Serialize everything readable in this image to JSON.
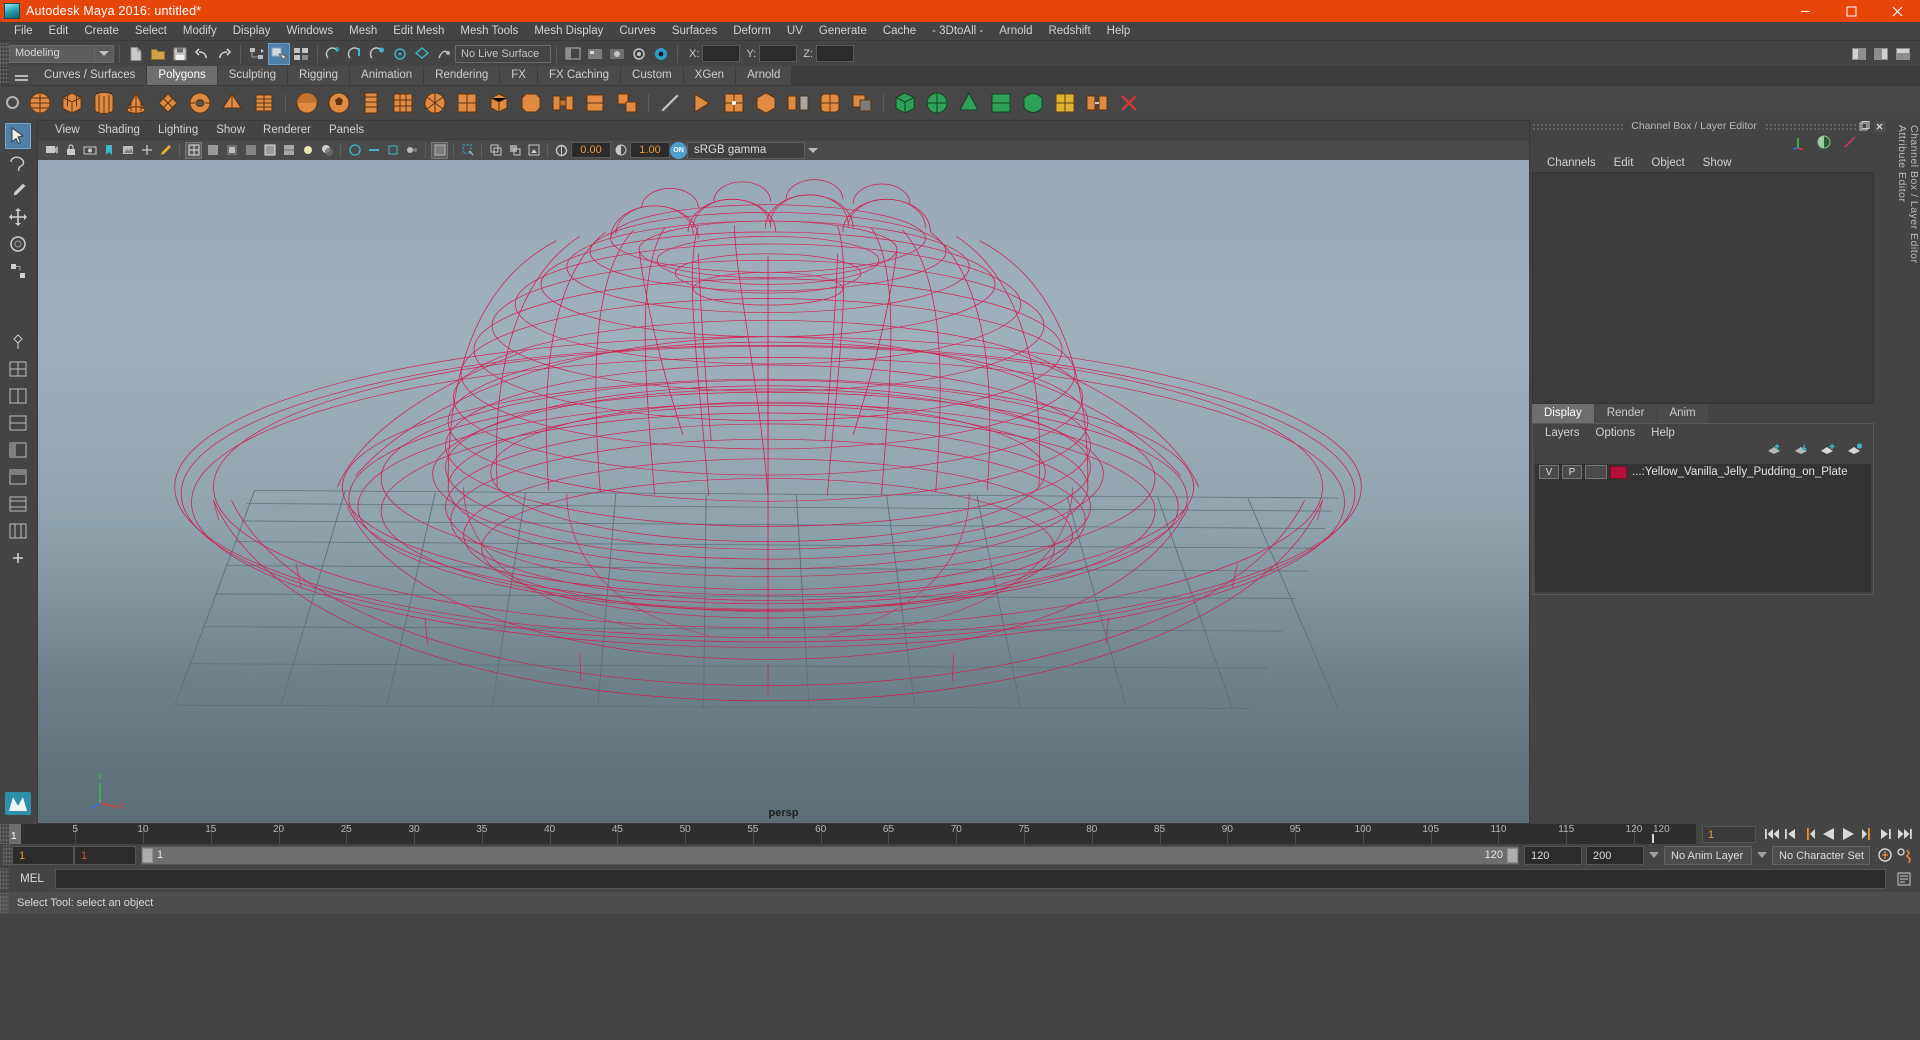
{
  "window": {
    "title": "Autodesk Maya 2016: untitled*",
    "logo_icon": "maya-logo-icon",
    "minimize_icon": "minimize-icon",
    "maximize_icon": "maximize-icon",
    "close_icon": "close-icon"
  },
  "menubar": {
    "items": [
      "File",
      "Edit",
      "Create",
      "Select",
      "Modify",
      "Display",
      "Windows",
      "Mesh",
      "Edit Mesh",
      "Mesh Tools",
      "Mesh Display",
      "Curves",
      "Surfaces",
      "Deform",
      "UV",
      "Generate",
      "Cache",
      "- 3DtoAll -",
      "Arnold",
      "Redshift",
      "Help"
    ]
  },
  "statusline": {
    "mode_selector": "Modeling",
    "live_surface": "No Live Surface",
    "axis_x_label": "X:",
    "axis_y_label": "Y:",
    "axis_z_label": "Z:",
    "axis_x_value": "",
    "axis_y_value": "",
    "axis_z_value": ""
  },
  "shelf": {
    "tabs": [
      "Curves / Surfaces",
      "Polygons",
      "Sculpting",
      "Rigging",
      "Animation",
      "Rendering",
      "FX",
      "FX Caching",
      "Custom",
      "XGen",
      "Arnold"
    ],
    "selected_tab": "Polygons"
  },
  "viewport": {
    "menu": [
      "View",
      "Shading",
      "Lighting",
      "Show",
      "Renderer",
      "Panels"
    ],
    "exposure_value": "0.00",
    "gamma_value": "1.00",
    "color_management_toggle": "ON",
    "color_profile": "sRGB gamma",
    "camera_label": "persp",
    "wireframe_color": "#d61a4b",
    "grid_color": "#5d6f78",
    "axis_labels": {
      "y": "Y",
      "x": "X",
      "z": "Z"
    }
  },
  "channelbox": {
    "panel_title": "Channel Box / Layer Editor",
    "menu": [
      "Channels",
      "Edit",
      "Object",
      "Show"
    ],
    "float_icon": "float-panel-icon",
    "close_icon": "close-panel-icon"
  },
  "layereditor": {
    "tabs": [
      "Display",
      "Render",
      "Anim"
    ],
    "selected_tab": "Display",
    "menu": [
      "Layers",
      "Options",
      "Help"
    ],
    "toolbar_icons": [
      "move-layer-up-icon",
      "move-layer-down-icon",
      "new-layer-icon",
      "new-layer-from-selected-icon"
    ],
    "layers": [
      {
        "visibility": "V",
        "playback": "P",
        "shading": "",
        "color": "#b2103a",
        "name": "...:Yellow_Vanilla_Jelly_Pudding_on_Plate"
      }
    ]
  },
  "right_rail": {
    "tabs": [
      "Channel Box / Layer Editor",
      "Attribute Editor"
    ]
  },
  "timeline": {
    "current_frame": "1",
    "start_display": "1",
    "end_display": "120",
    "ticks": [
      5,
      10,
      15,
      20,
      25,
      30,
      35,
      40,
      45,
      50,
      55,
      60,
      65,
      70,
      75,
      80,
      85,
      90,
      95,
      100,
      105,
      110,
      115,
      120
    ],
    "playback_icons": [
      "go-to-start-icon",
      "step-back-key-icon",
      "step-back-frame-icon",
      "play-backwards-icon",
      "play-forwards-icon",
      "step-forward-frame-icon",
      "step-forward-key-icon",
      "go-to-end-icon"
    ]
  },
  "rangeslider": {
    "anim_start": "1",
    "range_start": "1",
    "slider_start_label": "1",
    "slider_end_label": "120",
    "range_end": "120",
    "anim_end": "200",
    "anim_layer": "No Anim Layer",
    "character_set": "No Character Set",
    "auto_key_icon": "auto-keyframe-icon",
    "anim_prefs_icon": "animation-preferences-icon"
  },
  "commandline": {
    "language_label": "MEL",
    "command_value": "",
    "script_editor_icon": "script-editor-icon"
  },
  "statusbar": {
    "help_text": "Select Tool: select an object"
  }
}
